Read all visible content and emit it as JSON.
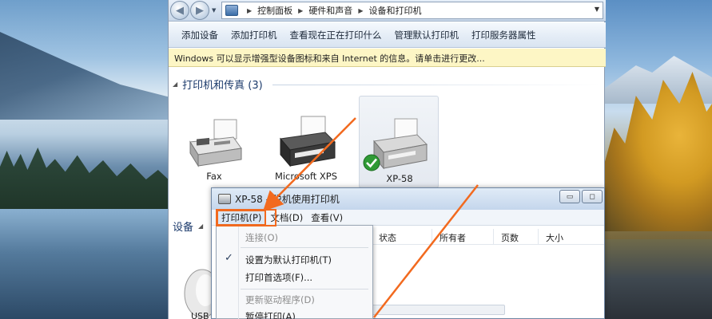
{
  "address": {
    "crumbs": [
      "控制面板",
      "硬件和声音",
      "设备和打印机"
    ]
  },
  "commands": [
    "添加设备",
    "添加打印机",
    "查看现在正在打印什么",
    "管理默认打印机",
    "打印服务器属性"
  ],
  "infobar": "Windows 可以显示增强型设备图标和来自 Internet 的信息。请单击进行更改...",
  "printers_group": "打印机和传真 (3)",
  "devices_group": "设备",
  "printers": [
    {
      "label": "Fax"
    },
    {
      "label": "Microsoft XPS"
    },
    {
      "label": "XP-58",
      "default": true
    }
  ],
  "usb_label": "USB",
  "queue_window": {
    "title": "XP-58 - 脱机使用打印机",
    "menus": [
      "打印机(P)",
      "文档(D)",
      "查看(V)"
    ],
    "columns": [
      "状态",
      "所有者",
      "页数",
      "大小"
    ],
    "controls": [
      "▭",
      "◻"
    ]
  },
  "printer_menu": {
    "items": [
      {
        "label": "连接(O)",
        "disabled": true
      },
      {
        "label": "设置为默认打印机(T)",
        "checked": true
      },
      {
        "label": "打印首选项(F)..."
      },
      {
        "label": "更新驱动程序(D)",
        "disabled": true
      },
      {
        "label": "暂停打印(A)"
      }
    ]
  },
  "colors": {
    "accent_orange": "#f26a1f",
    "link_blue": "#1b3a6b",
    "infobar_bg": "#fdf6c5"
  }
}
